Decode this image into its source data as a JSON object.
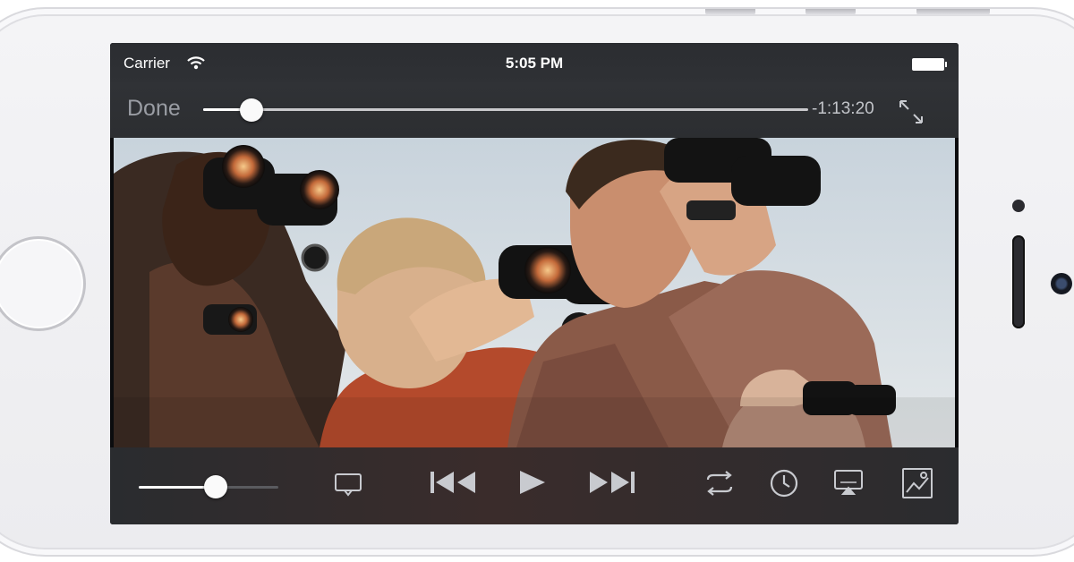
{
  "status_bar": {
    "carrier": "Carrier",
    "time": "5:05 PM",
    "wifi_icon": "wifi-icon",
    "battery_icon": "battery-icon"
  },
  "player": {
    "done_label": "Done",
    "time_remaining": "-1:13:20",
    "playback_progress": 0.08,
    "volume_level": 0.55,
    "icons": {
      "fullscreen": "fullscreen-icon",
      "subtitles": "speech-bubble-icon",
      "previous": "skip-back-icon",
      "play": "play-icon",
      "next": "skip-forward-icon",
      "repeat": "repeat-icon",
      "timer": "clock-icon",
      "airplay": "airplay-icon",
      "picture": "picture-icon"
    }
  },
  "colors": {
    "control_tint": "#c8cacf",
    "bar_background": "#2e3033",
    "thumb": "#fafafa"
  }
}
